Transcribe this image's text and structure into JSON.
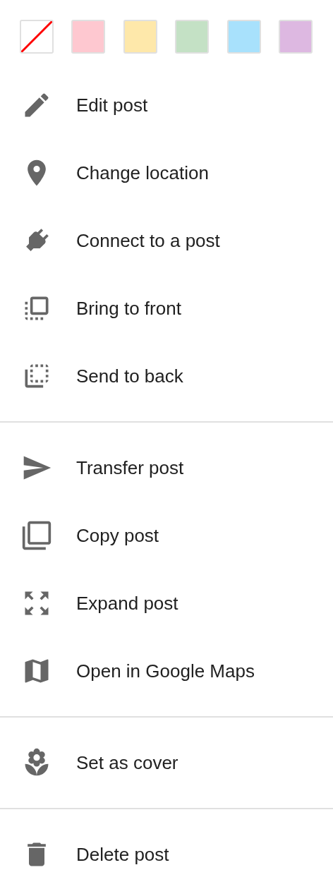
{
  "swatches": [
    {
      "kind": "none",
      "color": "#ffffff"
    },
    {
      "kind": "color",
      "color": "#fec8d0"
    },
    {
      "kind": "color",
      "color": "#fee8aa"
    },
    {
      "kind": "color",
      "color": "#c4e1c5"
    },
    {
      "kind": "color",
      "color": "#a8e1fc"
    },
    {
      "kind": "color",
      "color": "#ddb8e1"
    }
  ],
  "sections": [
    {
      "items": [
        {
          "label": "Edit post"
        },
        {
          "label": "Change location"
        },
        {
          "label": "Connect to a post"
        },
        {
          "label": "Bring to front"
        },
        {
          "label": "Send to back"
        }
      ]
    },
    {
      "items": [
        {
          "label": "Transfer post"
        },
        {
          "label": "Copy post"
        },
        {
          "label": "Expand post"
        },
        {
          "label": "Open in Google Maps"
        }
      ]
    },
    {
      "items": [
        {
          "label": "Set as cover"
        }
      ]
    },
    {
      "items": [
        {
          "label": "Delete post"
        }
      ]
    }
  ]
}
